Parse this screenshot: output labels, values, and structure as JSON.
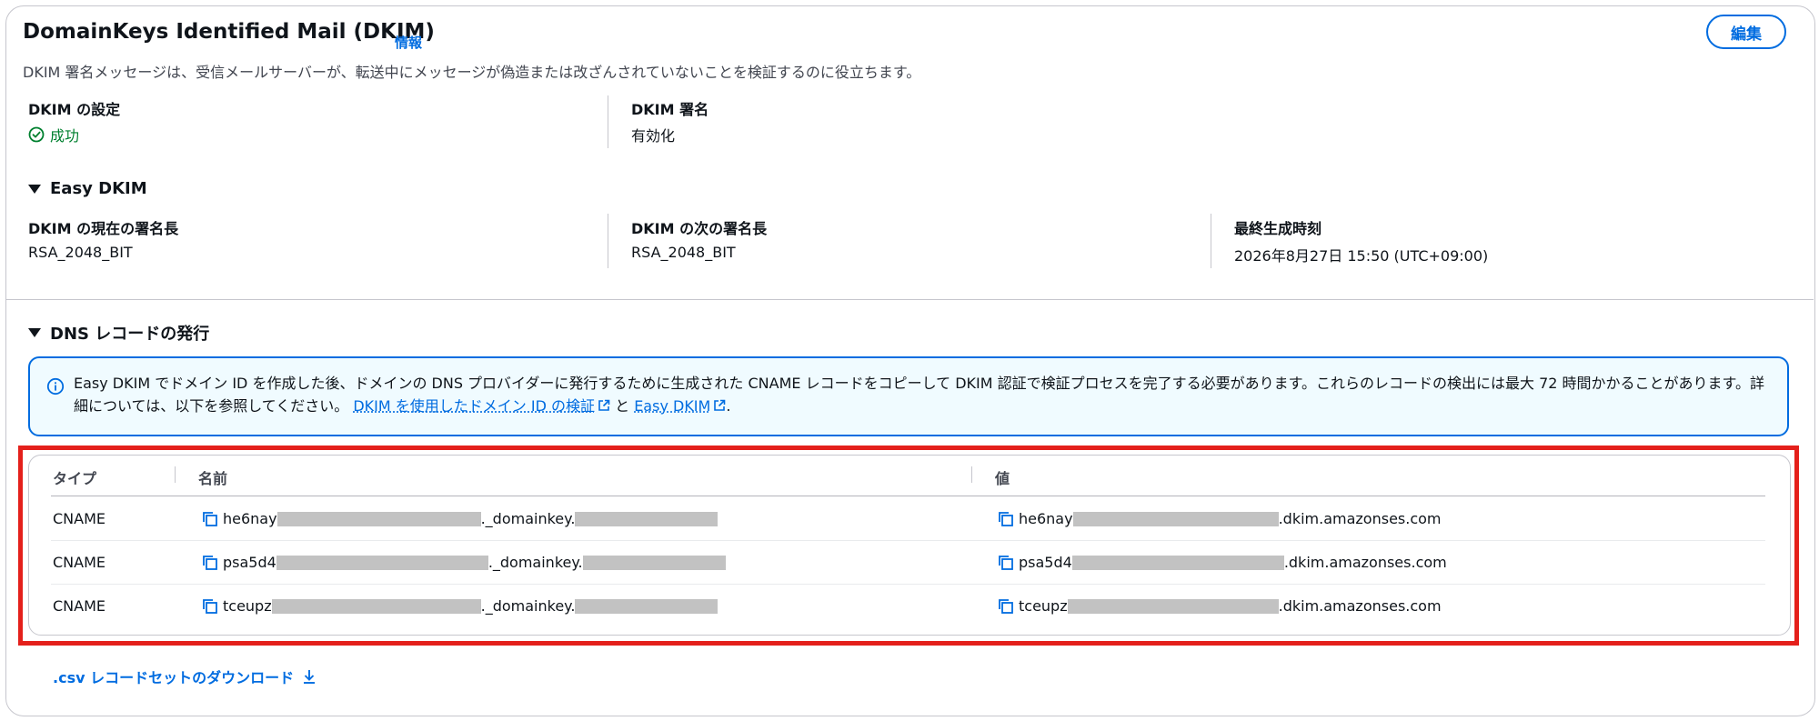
{
  "header": {
    "title": "DomainKeys Identified Mail (DKIM)",
    "info_link": "情報",
    "description": "DKIM 署名メッセージは、受信メールサーバーが、転送中にメッセージが偽造または改ざんされていないことを検証するのに役立ちます。",
    "edit_button": "編集"
  },
  "dkim_config": {
    "label": "DKIM の設定",
    "value": "成功",
    "status_color": "#00802f"
  },
  "dkim_signing": {
    "label": "DKIM 署名",
    "value": "有効化"
  },
  "easy_dkim": {
    "section_title": "Easy DKIM",
    "current_key_length_label": "DKIM の現在の署名長",
    "current_key_length_value": "RSA_2048_BIT",
    "next_key_length_label": "DKIM の次の署名長",
    "next_key_length_value": "RSA_2048_BIT",
    "last_generated_label": "最終生成時刻",
    "last_generated_value": "2026年8月27日 15:50 (UTC+09:00)"
  },
  "dns_records": {
    "section_title": "DNS レコードの発行",
    "info_text_1": "Easy DKIM でドメイン ID を作成した後、ドメインの DNS プロバイダーに発行するために生成された CNAME レコードをコピーして DKIM 認証で検証プロセスを完了する必要があります。これらのレコードの検出には最大 72 時間かかることがあります。詳細については、以下を参照してください。",
    "info_link_1": "DKIM を使用したドメイン ID の検証",
    "info_conjunction": "と",
    "info_link_2": "Easy DKIM",
    "info_period": ".",
    "columns": {
      "type": "タイプ",
      "name": "名前",
      "value": "値"
    },
    "rows": [
      {
        "type": "CNAME",
        "name_prefix": "he6nay",
        "name_mid": "._domainkey.",
        "value_prefix": "he6nay",
        "value_suffix": ".dkim.amazonses.com"
      },
      {
        "type": "CNAME",
        "name_prefix": "psa5d4",
        "name_mid": "._domainkey.",
        "value_prefix": "psa5d4",
        "value_suffix": ".dkim.amazonses.com"
      },
      {
        "type": "CNAME",
        "name_prefix": "tceupz",
        "name_mid": "._domainkey.",
        "value_prefix": "tceupz",
        "value_suffix": ".dkim.amazonses.com"
      }
    ],
    "download_link": ".csv レコードセットのダウンロード"
  },
  "colors": {
    "accent": "#006ce0",
    "highlight_border": "#e4201b",
    "info_bg": "#f0fbff",
    "redaction": "#c2c2c2"
  },
  "icons": [
    "info-icon",
    "check-circle-icon",
    "external-link-icon",
    "copy-icon",
    "download-icon",
    "caret-down-icon"
  ]
}
